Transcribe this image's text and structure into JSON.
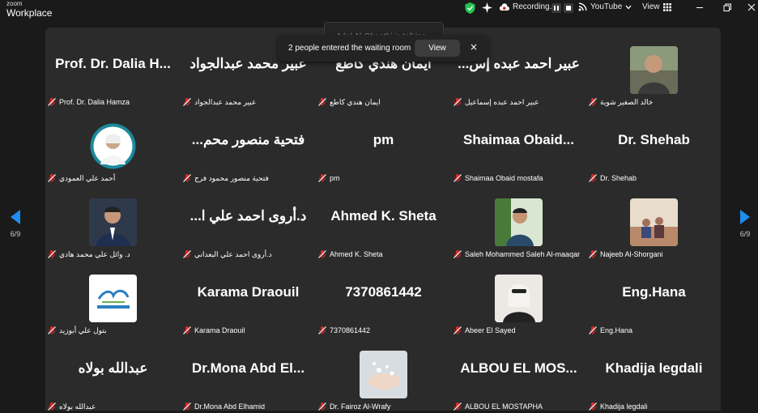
{
  "app": {
    "brand_top": "zoom",
    "brand_bottom": "Workplace"
  },
  "toolbar": {
    "recording": "Recording...",
    "youtube": "YouTube",
    "view": "View"
  },
  "notification": {
    "talking": "Adel Al-Gheethi is talking",
    "message": "2 people entered the waiting room",
    "view_label": "View",
    "close": "×"
  },
  "pager": {
    "left": "6/9",
    "right": "6/9"
  },
  "colors": {
    "accent": "#0e71eb",
    "muted_mic": "#e02828",
    "shield": "#23c552"
  },
  "tiles": [
    {
      "big": "Prof. Dr. Dalia H...",
      "name": "Prof. Dr. Dalia Hamza"
    },
    {
      "big": "عبير محمد عبدالجواد",
      "name": "عبير محمد عبدالجواد"
    },
    {
      "big": "ايمان هندي كاطع",
      "name": "ايمان هندي كاطع"
    },
    {
      "big": "...عبير احمد عبده إس",
      "name": "عبير احمد عبده إسماعيل"
    },
    {
      "big": "",
      "name": "خالد الصغير شوية"
    },
    {
      "big": "",
      "name": "أحمد علي العمودي"
    },
    {
      "big": "...فتحية منصور محم",
      "name": "فتحية منصور محمود فرج"
    },
    {
      "big": "pm",
      "name": "pm"
    },
    {
      "big": "Shaimaa  Obaid...",
      "name": "Shaimaa Obaid mostafa"
    },
    {
      "big": "Dr. Shehab",
      "name": "Dr. Shehab"
    },
    {
      "big": "",
      "name": "د. وائل علي محمد هادي"
    },
    {
      "big": "...د.أروى احمد علي ا",
      "name": "د.أروى احمد علي البعداني"
    },
    {
      "big": "Ahmed K. Sheta",
      "name": "Ahmed K. Sheta"
    },
    {
      "big": "",
      "name": "Saleh Mohammed Saleh Al-maaqar"
    },
    {
      "big": "",
      "name": "Najeeb Al-Shorgani"
    },
    {
      "big": "",
      "name": "بتول علي أبوزيد"
    },
    {
      "big": "Karama Draouil",
      "name": "Karama Draouil"
    },
    {
      "big": "7370861442",
      "name": "7370861442"
    },
    {
      "big": "",
      "name": "Abeer El Sayed"
    },
    {
      "big": "Eng.Hana",
      "name": "Eng.Hana"
    },
    {
      "big": "عبدالله بولاه",
      "name": "عبدالله بولاه"
    },
    {
      "big": "Dr.Mona Abd El...",
      "name": "Dr.Mona Abd Elhamid"
    },
    {
      "big": "",
      "name": "Dr. Fairoz Al-Wrafy"
    },
    {
      "big": "ALBOU  EL MOS...",
      "name": "ALBOU EL MOSTAPHA"
    },
    {
      "big": "Khadija legdali",
      "name": "Khadija legdali"
    }
  ]
}
